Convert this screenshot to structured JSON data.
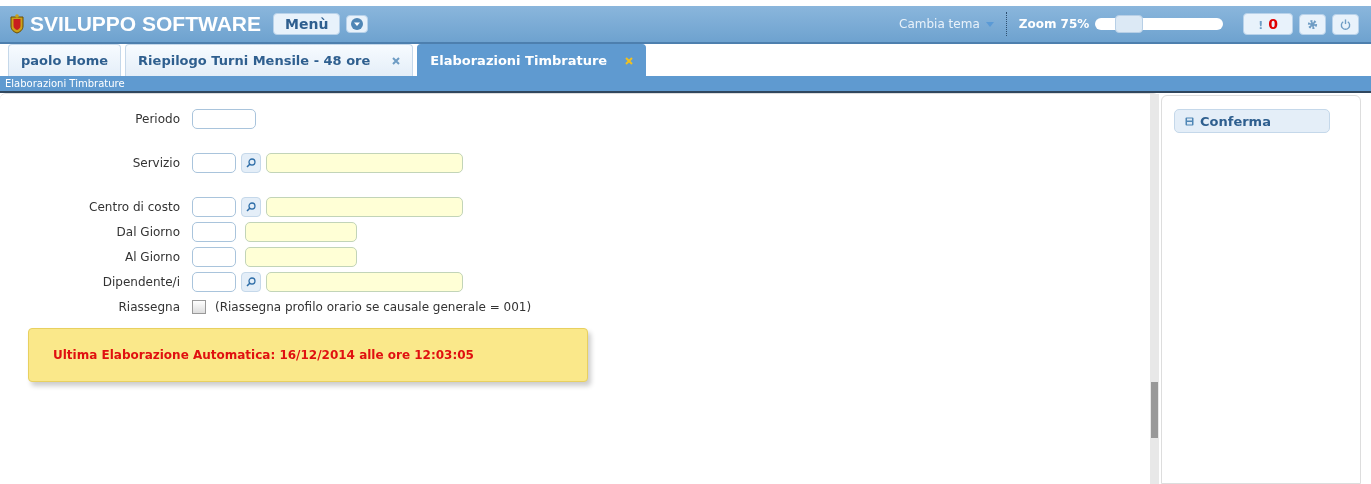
{
  "header": {
    "title": "SVILUPPO SOFTWARE",
    "menu_button": "Menù",
    "theme_menu": "Cambia tema",
    "zoom_label": "Zoom 75%",
    "zoom": {
      "level": 0.2
    },
    "alerts": {
      "icon": "!",
      "count": "0"
    }
  },
  "tabs": [
    {
      "label": "paolo Home",
      "selected": false,
      "closable": false
    },
    {
      "label": "Riepilogo Turni Mensile - 48 ore",
      "selected": false,
      "closable": true
    },
    {
      "label": "Elaborazioni Timbrature",
      "selected": true,
      "closable": true
    }
  ],
  "breadcrumb": "Elaborazioni Timbrature",
  "form_groups": [
    [
      {
        "kind": "period",
        "label": "Periodo"
      }
    ],
    [
      {
        "kind": "lookup",
        "label": "Servizio"
      }
    ],
    [
      {
        "kind": "lookup",
        "label": "Centro di costo"
      },
      {
        "kind": "date",
        "label": "Dal Giorno"
      },
      {
        "kind": "date",
        "label": "Al Giorno"
      },
      {
        "kind": "lookup",
        "label": "Dipendente/i"
      },
      {
        "kind": "checkbox",
        "label": "Riassegna",
        "checked": false,
        "note": "(Riassegna profilo orario se causale generale = 001)"
      }
    ]
  ],
  "notice": "Ultima Elaborazione Automatica: 16/12/2014 alle ore 12:03:05",
  "actions": [
    {
      "label": "Conferma"
    }
  ]
}
